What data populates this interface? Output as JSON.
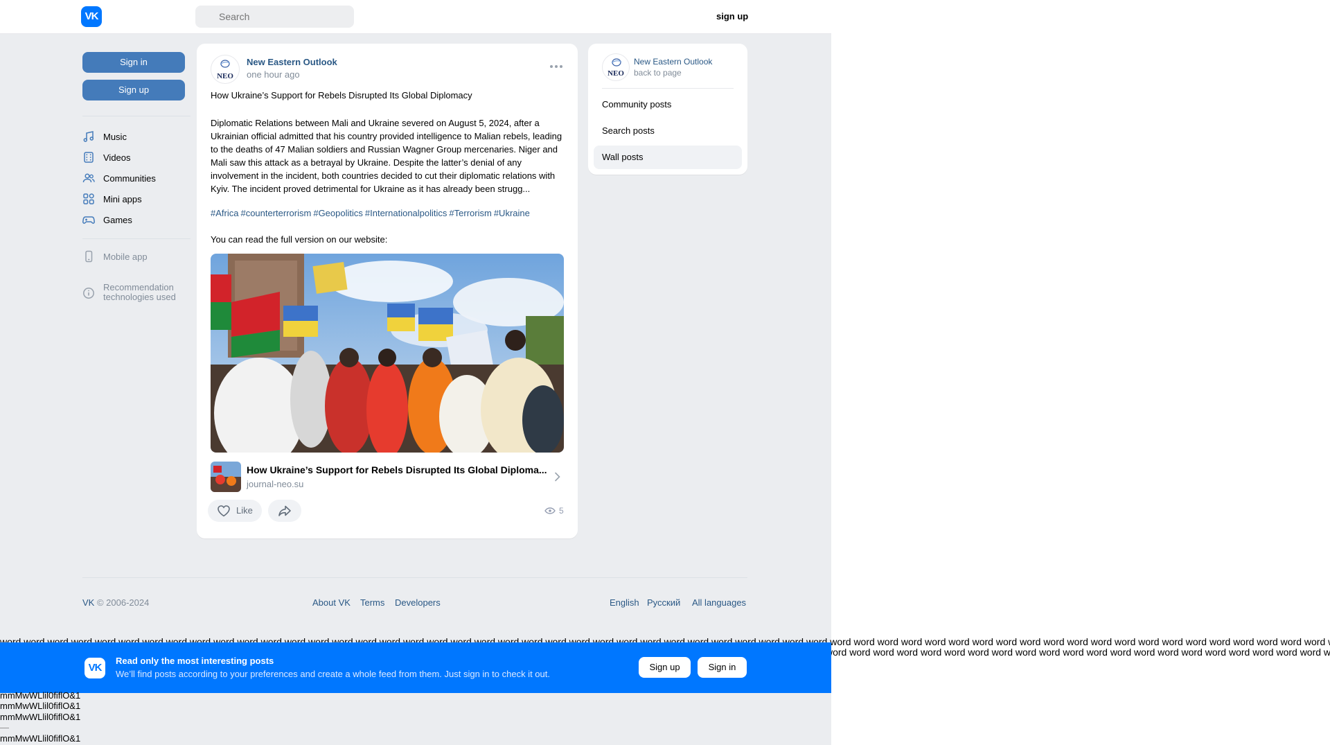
{
  "header": {
    "logo": "VK",
    "search_placeholder": "Search",
    "signup_label": "sign up"
  },
  "sidebar": {
    "signin_label": "Sign in",
    "signup_label": "Sign up",
    "items": [
      {
        "label": "Music",
        "icon": "music-note-icon"
      },
      {
        "label": "Videos",
        "icon": "video-icon"
      },
      {
        "label": "Communities",
        "icon": "users-icon"
      },
      {
        "label": "Mini apps",
        "icon": "apps-icon"
      },
      {
        "label": "Games",
        "icon": "gamepad-icon"
      }
    ],
    "mobile_app": "Mobile app",
    "recommendation_line1": "Recommendation",
    "recommendation_line2": "technologies used"
  },
  "post": {
    "author": "New Eastern Outlook",
    "avatar_text": "NEO",
    "time": "one hour ago",
    "title": "How Ukraine’s Support for Rebels Disrupted Its Global Diplomacy",
    "body": "Diplomatic Relations between Mali and Ukraine severed on August 5, 2024, after a Ukrainian official admitted that his country provided intelligence to Malian rebels, leading to the deaths of 47 Malian soldiers and Russian Wagner Group mercenaries. Niger and Mali saw this attack as a betrayal by Ukraine. Despite the latter’s denial of any involvement in the incident, both countries decided to cut their diplomatic relations with Kyiv. The incident proved detrimental for Ukraine as it has already been strugg...",
    "tags": [
      "#Africa",
      "#counterterrorism",
      "#Geopolitics",
      "#Internationalpolitics",
      "#Terrorism",
      "#Ukraine"
    ],
    "full_version": "You can read the full version on our website:",
    "link_title": "How Ukraine’s Support for Rebels Disrupted Its Global Diploma...",
    "link_domain": "journal-neo.su",
    "like_label": "Like",
    "views": "5"
  },
  "side_panel": {
    "author": "New Eastern Outlook",
    "back": "back to page",
    "items": [
      {
        "label": "Community posts"
      },
      {
        "label": "Search posts"
      },
      {
        "label": "Wall posts",
        "active": true
      }
    ]
  },
  "footer": {
    "copyright_brand": "VK",
    "copyright_rest": " © 2006-2024",
    "links": [
      "About VK",
      "Terms",
      "Developers"
    ],
    "languages": [
      "English",
      "Русский",
      "All languages"
    ]
  },
  "banner": {
    "title": "Read only the most interesting posts",
    "subtitle": "We’ll find posts according to your preferences and create a whole feed from them. Just sign in to check it out.",
    "signup": "Sign up",
    "signin": "Sign in"
  },
  "junk": {
    "words_line": "word word word word word word word word word word word word word word word word word word word word word word word word word word word word word word word word word word word word word word word word word word word word word word word word word word word word word word word word word word word word word word word word word word word word word word word word word",
    "words_line2": "word word word word word word word word word word word word word word word word word word word word word word word word word word word word",
    "m1": "mmMwWLlil0fiflO&1",
    "m2": "mmMwWLlil0fiflO&1",
    "m3": "mmMwWLlil0fiflO&1",
    "dash": "—",
    "m4": "mmMwWLlil0fiflO&1"
  },
  "colors": {
    "accent": "#0077ff",
    "button": "#447bba",
    "link": "#2a5885",
    "background": "#ebedf0"
  }
}
